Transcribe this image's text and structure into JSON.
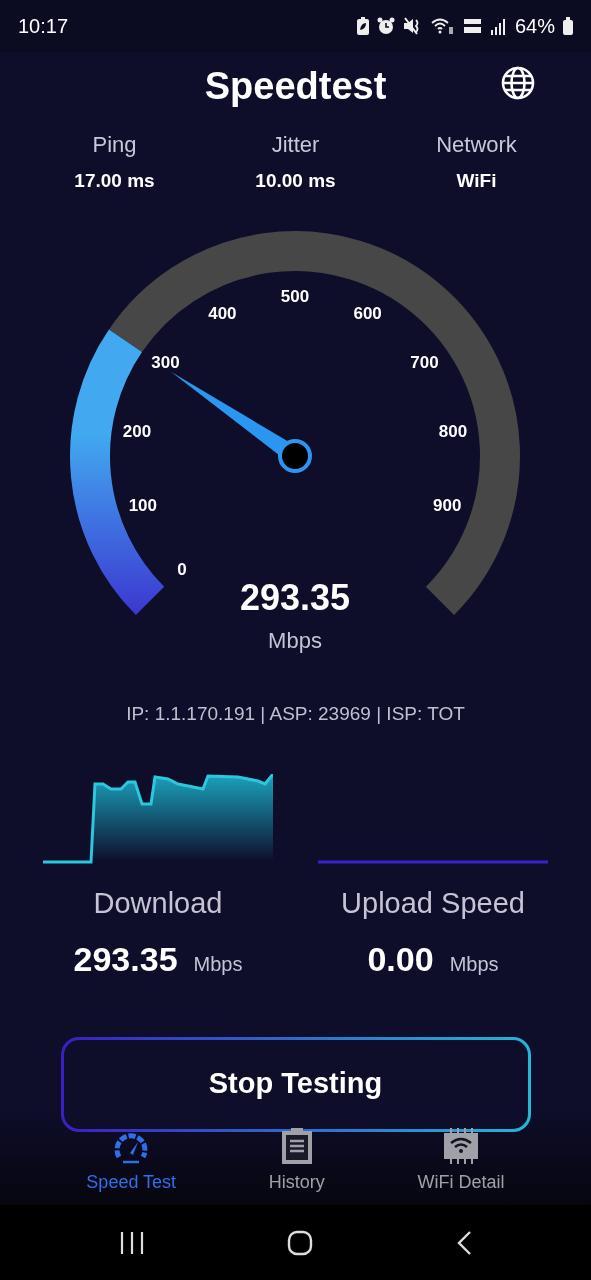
{
  "status_bar": {
    "time": "10:17",
    "battery": "64%"
  },
  "header": {
    "title": "Speedtest"
  },
  "stats": [
    {
      "label": "Ping",
      "value": "17.00 ms"
    },
    {
      "label": "Jitter",
      "value": "10.00 ms"
    },
    {
      "label": "Network",
      "value": "WiFi"
    }
  ],
  "gauge": {
    "ticks": [
      "0",
      "100",
      "200",
      "300",
      "400",
      "500",
      "600",
      "700",
      "800",
      "900"
    ],
    "reading": "293.35",
    "unit": "Mbps"
  },
  "connection_info": "IP: 1.1.170.191 | ASP: 23969 | ISP: TOT",
  "results": [
    {
      "kind": "download",
      "label": "Download",
      "value": "293.35",
      "unit": "Mbps"
    },
    {
      "kind": "upload",
      "label": "Upload Speed",
      "value": "0.00",
      "unit": "Mbps"
    }
  ],
  "action_button": "Stop Testing",
  "bottom_nav": [
    {
      "label": "Speed Test",
      "selected": true
    },
    {
      "label": "History",
      "selected": false
    },
    {
      "label": "WiFi Detail",
      "selected": false
    }
  ]
}
